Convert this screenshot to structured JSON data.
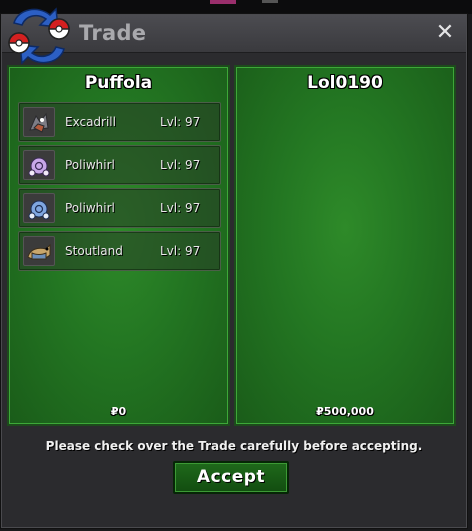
{
  "window": {
    "title": "Trade",
    "close_symbol": "✕"
  },
  "left_panel": {
    "player": "Puffola",
    "pokemon": [
      {
        "name": "Excadrill",
        "level": "Lvl: 97",
        "icon": "excadrill-icon"
      },
      {
        "name": "Poliwhirl",
        "level": "Lvl: 97",
        "icon": "poliwhirl-icon"
      },
      {
        "name": "Poliwhirl",
        "level": "Lvl: 97",
        "icon": "poliwhirl-icon"
      },
      {
        "name": "Stoutland",
        "level": "Lvl: 97",
        "icon": "stoutland-icon"
      }
    ],
    "money": "₽0"
  },
  "right_panel": {
    "player": "Lol0190",
    "money": "₽500,000"
  },
  "notice": "Please check over the Trade carefully before accepting.",
  "accept_label": "Accept",
  "colors": {
    "panel_green": "#237622",
    "button_green": "#1f6a1b",
    "window_bg": "#2b2b2e",
    "title_text": "#a9a9ad"
  }
}
